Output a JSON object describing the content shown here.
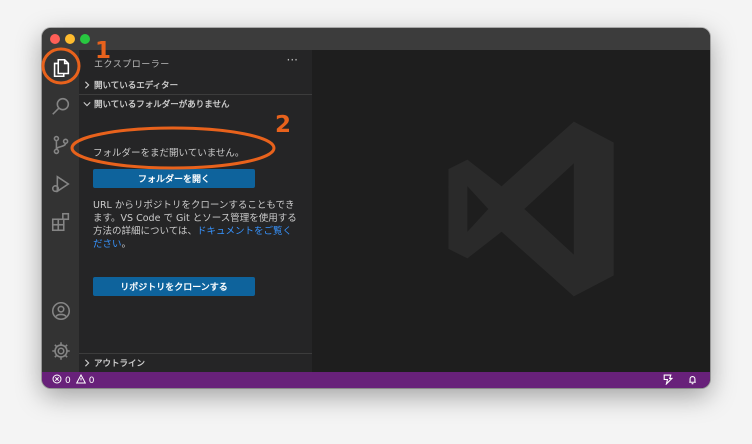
{
  "sidebar": {
    "title": "エクスプローラー",
    "more": "···",
    "open_editors": "開いているエディター",
    "no_folder": "開いているフォルダーがありません",
    "msg1": "フォルダーをまだ開いていません。",
    "open_folder_button": "フォルダーを開く",
    "msg2": "URL からリポジトリをクローンすることもできます。VS Code で Git とソース管理を使用する方法の詳細については、",
    "msg2_link": "ドキュメントをご覧ください",
    "msg2_end": "。",
    "clone_button": "リポジトリをクローンする",
    "outline": "アウトライン"
  },
  "statusbar": {
    "errors": "0",
    "warnings": "0"
  },
  "annotations": {
    "one": "1",
    "two": "2"
  },
  "colors": {
    "accent": "#e8621c",
    "statusbar": "#68217a",
    "button": "#0e639c",
    "link": "#3794ff"
  }
}
